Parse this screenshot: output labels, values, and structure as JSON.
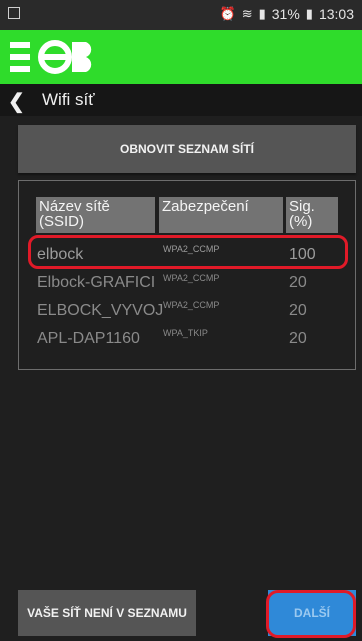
{
  "status_bar": {
    "battery": "31%",
    "time": "13:03"
  },
  "navbar": {
    "title": "Wifi síť"
  },
  "refresh_button": {
    "label": "OBNOVIT SEZNAM SÍTÍ"
  },
  "table": {
    "headers": [
      "Název sítě (SSID)",
      "Zabezpečení",
      "Sig.(%)"
    ],
    "rows": [
      {
        "ssid": "elbock",
        "security": "WPA2_CCMP",
        "signal": "100"
      },
      {
        "ssid": "Elbock-GRAFICI",
        "security": "WPA2_CCMP",
        "signal": "20"
      },
      {
        "ssid": "ELBOCK_VYVOJ",
        "security": "WPA2_CCMP",
        "signal": "20"
      },
      {
        "ssid": "APL-DAP1160",
        "security": "WPA_TKIP",
        "signal": "20"
      }
    ]
  },
  "footer": {
    "network_not_listed_label": "VAŠE SÍŤ NENÍ V SEZNAMU",
    "next_label": "DALŠÍ"
  }
}
